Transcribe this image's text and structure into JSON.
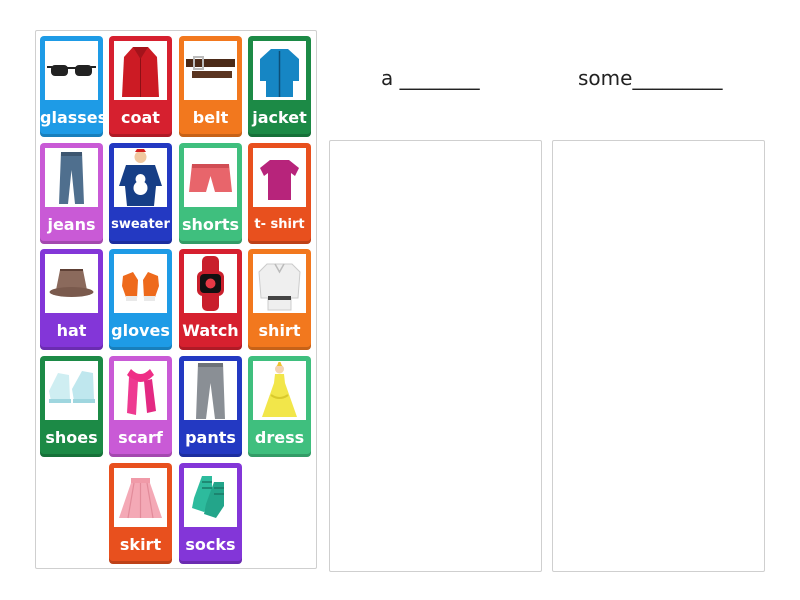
{
  "headings": {
    "a": "a ________",
    "some": "some_________"
  },
  "cards": [
    {
      "label": "glasses",
      "color": "#1e9be6",
      "icon": "glasses-icon"
    },
    {
      "label": "coat",
      "color": "#d6202f",
      "icon": "coat-icon"
    },
    {
      "label": "belt",
      "color": "#f2781e",
      "icon": "belt-icon"
    },
    {
      "label": "jacket",
      "color": "#1c8a46",
      "icon": "jacket-icon"
    },
    {
      "label": "jeans",
      "color": "#c95ad6",
      "icon": "jeans-icon"
    },
    {
      "label": "sweater",
      "color": "#2339c2",
      "icon": "sweater-icon"
    },
    {
      "label": "shorts",
      "color": "#3fbf7e",
      "icon": "shorts-icon"
    },
    {
      "label": "t- shirt",
      "color": "#e8501e",
      "icon": "tshirt-icon"
    },
    {
      "label": "hat",
      "color": "#8336d8",
      "icon": "hat-icon"
    },
    {
      "label": "gloves",
      "color": "#1e9be6",
      "icon": "gloves-icon"
    },
    {
      "label": "Watch",
      "color": "#d6202f",
      "icon": "watch-icon"
    },
    {
      "label": "shirt",
      "color": "#f2781e",
      "icon": "shirt-icon"
    },
    {
      "label": "shoes",
      "color": "#1c8a46",
      "icon": "shoes-icon"
    },
    {
      "label": "scarf",
      "color": "#c95ad6",
      "icon": "scarf-icon"
    },
    {
      "label": "pants",
      "color": "#2339c2",
      "icon": "pants-icon"
    },
    {
      "label": "dress",
      "color": "#3fbf7e",
      "icon": "dress-icon"
    },
    {
      "label": "skirt",
      "color": "#e8501e",
      "icon": "skirt-icon"
    },
    {
      "label": "socks",
      "color": "#8336d8",
      "icon": "socks-icon"
    }
  ]
}
